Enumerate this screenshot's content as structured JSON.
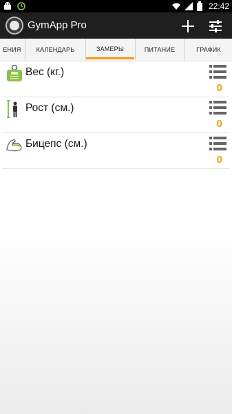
{
  "status_bar": {
    "time": "22:42",
    "icons": [
      "android-icon",
      "clock-app-icon",
      "wifi-icon",
      "signal-icon",
      "battery-icon"
    ]
  },
  "action_bar": {
    "title": "GymApp Pro",
    "add_icon": "plus-icon",
    "settings_icon": "sliders-icon"
  },
  "tabs": [
    {
      "label": "ЕНИЯ"
    },
    {
      "label": "КАЛЕНДАРЬ"
    },
    {
      "label": "ЗАМЕРЫ",
      "active": true
    },
    {
      "label": "ПИТАНИЕ"
    },
    {
      "label": "ГРАФИК"
    }
  ],
  "measurements": [
    {
      "label": "Вес (кг.)",
      "value": "0",
      "icon": "scale-icon"
    },
    {
      "label": "Рост (см.)",
      "value": "0",
      "icon": "height-icon"
    },
    {
      "label": "Бицепс (см.)",
      "value": "0",
      "icon": "biceps-icon"
    }
  ],
  "colors": {
    "accent": "#f39c12",
    "action_bar": "#1f1f1f",
    "icon_green": "#8bc34a"
  }
}
